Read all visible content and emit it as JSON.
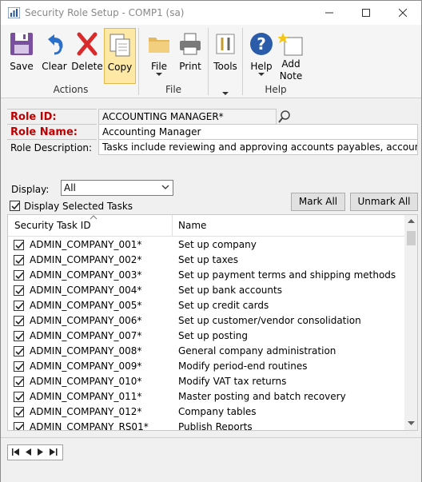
{
  "window": {
    "title": "Security Role Setup  -  COMP1 (sa)"
  },
  "ribbon": {
    "save": "Save",
    "clear": "Clear",
    "delete": "Delete",
    "copy": "Copy",
    "file": "File",
    "print": "Print",
    "tools": "Tools",
    "help": "Help",
    "add_note_1": "Add",
    "add_note_2": "Note",
    "groups": {
      "actions": "Actions",
      "file": "File",
      "help": "Help"
    }
  },
  "form": {
    "role_id_label": "Role ID:",
    "role_id_value": "ACCOUNTING MANAGER*",
    "role_name_label": "Role Name:",
    "role_name_value": "Accounting Manager",
    "role_desc_label": "Role Description:",
    "role_desc_value": "Tasks include reviewing and approving accounts payables, accounts receivables, j"
  },
  "display": {
    "label": "Display:",
    "selected": "All",
    "checkbox_label": "Display Selected Tasks",
    "checkbox_checked": true,
    "mark_all": "Mark All",
    "unmark_all": "Unmark All"
  },
  "grid": {
    "headers": {
      "id": "Security Task ID",
      "name": "Name"
    },
    "rows": [
      {
        "id": "ADMIN_COMPANY_001*",
        "name": "Set up company",
        "checked": true
      },
      {
        "id": "ADMIN_COMPANY_002*",
        "name": "Set up taxes",
        "checked": true
      },
      {
        "id": "ADMIN_COMPANY_003*",
        "name": "Set up payment terms and shipping methods",
        "checked": true
      },
      {
        "id": "ADMIN_COMPANY_004*",
        "name": "Set up bank accounts",
        "checked": true
      },
      {
        "id": "ADMIN_COMPANY_005*",
        "name": "Set up credit cards",
        "checked": true
      },
      {
        "id": "ADMIN_COMPANY_006*",
        "name": "Set up customer/vendor consolidation",
        "checked": true
      },
      {
        "id": "ADMIN_COMPANY_007*",
        "name": "Set up posting",
        "checked": true
      },
      {
        "id": "ADMIN_COMPANY_008*",
        "name": "General company administration",
        "checked": true
      },
      {
        "id": "ADMIN_COMPANY_009*",
        "name": "Modify period-end routines",
        "checked": true
      },
      {
        "id": "ADMIN_COMPANY_010*",
        "name": "Modify VAT tax returns",
        "checked": true
      },
      {
        "id": "ADMIN_COMPANY_011*",
        "name": "Master posting and batch recovery",
        "checked": true
      },
      {
        "id": "ADMIN_COMPANY_012*",
        "name": "Company tables",
        "checked": true
      },
      {
        "id": "ADMIN_COMPANY_RS01*",
        "name": "Publish Reports",
        "checked": true
      }
    ]
  },
  "icons": {
    "app": "app-icon",
    "save": "save-icon",
    "clear": "undo-icon",
    "delete": "delete-x-icon",
    "copy": "copy-icon",
    "file": "folder-icon",
    "print": "printer-icon",
    "tools": "tools-icon",
    "help": "help-icon",
    "note": "add-note-icon",
    "lookup": "lookup-magnifier-icon"
  },
  "colors": {
    "required_label": "#c00000",
    "selected_button": "#fde8a6",
    "help_blue": "#2a5caa"
  }
}
